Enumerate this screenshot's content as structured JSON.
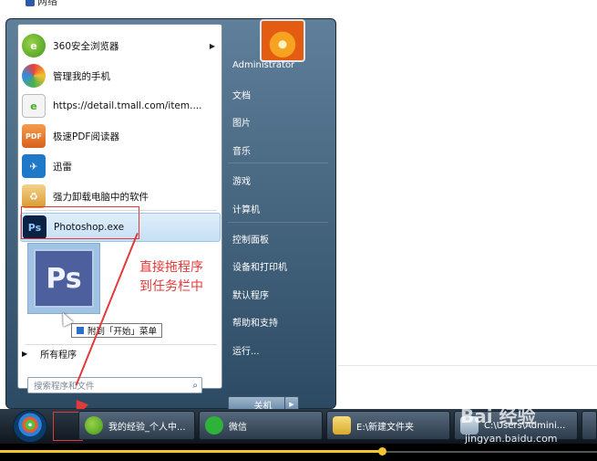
{
  "top_bar": {
    "network_label": "网络"
  },
  "start_menu": {
    "programs": [
      {
        "label": "360安全浏览器",
        "icon": "ie-browser-icon",
        "has_submenu": true
      },
      {
        "label": "管理我的手机",
        "icon": "phone-manager-icon"
      },
      {
        "label": "https://detail.tmall.com/item....",
        "icon": "web-document-icon"
      },
      {
        "label": "极速PDF阅读器",
        "icon": "pdf-reader-icon"
      },
      {
        "label": "迅雷",
        "icon": "xunlei-icon"
      },
      {
        "label": "强力卸载电脑中的软件",
        "icon": "uninstaller-icon"
      },
      {
        "label": "Photoshop.exe",
        "icon": "photoshop-icon"
      }
    ],
    "drag_preview_label": "Ps",
    "pin_tooltip": "附到「开始」菜单",
    "all_programs": "所有程序",
    "search_placeholder": "搜索程序和文件",
    "right_items": [
      "Administrator",
      "文档",
      "图片",
      "音乐",
      "游戏",
      "计算机",
      "控制面板",
      "设备和打印机",
      "默认程序",
      "帮助和支持",
      "运行..."
    ],
    "shutdown_label": "关机"
  },
  "annotation": {
    "line1": "直接拖程序",
    "line2": "到任务栏中"
  },
  "taskbar": {
    "buttons": [
      {
        "label": "我的经验_个人中...",
        "icon": "ie-browser-icon"
      },
      {
        "label": "微信",
        "icon": "wechat-icon"
      },
      {
        "label": "E:\\新建文件夹",
        "icon": "folder-icon"
      },
      {
        "label": "C:\\Users\\Admini...",
        "icon": "app-window-icon"
      }
    ]
  },
  "watermark": {
    "logo": "Bai 经验",
    "url": "jingyan.baidu.com"
  },
  "video_progress": {
    "fraction": 0.64
  },
  "colors": {
    "annotation_red": "#e23a3a",
    "progress_yellow": "#f2c531"
  }
}
